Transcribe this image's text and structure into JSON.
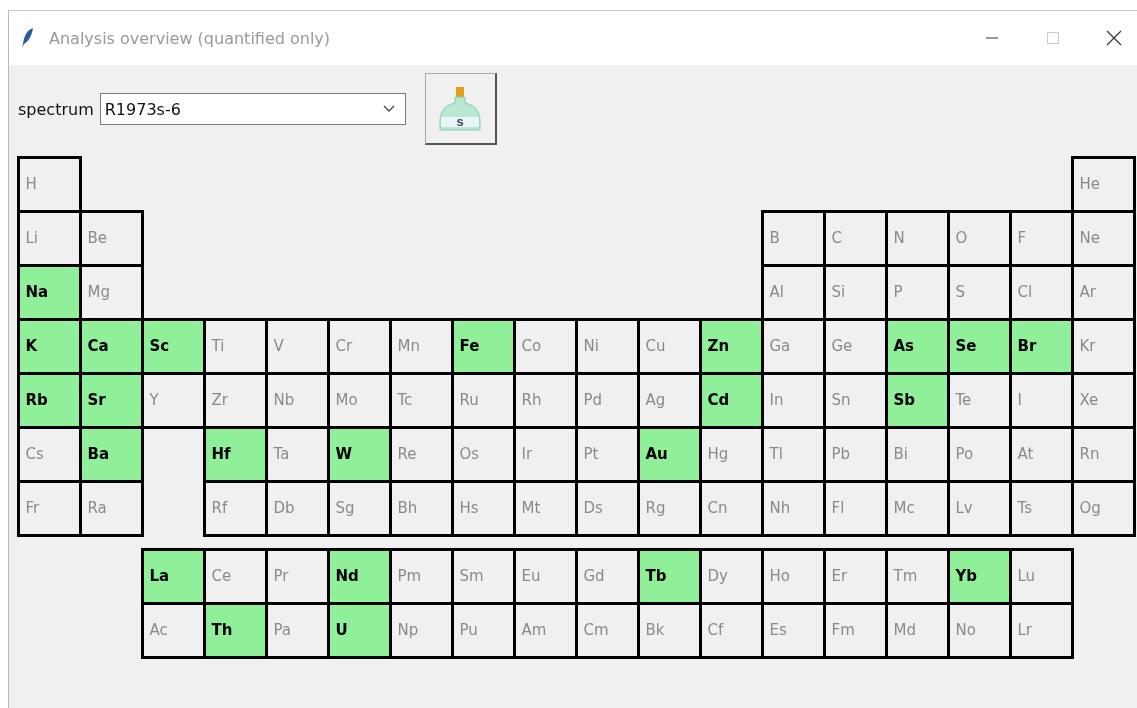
{
  "window": {
    "title": "Analysis overview (quantified only)"
  },
  "toolbar": {
    "label": "spectrum",
    "spectrum_select": {
      "value": "R1973s-6"
    },
    "flask_button": {
      "label": "s"
    }
  },
  "periods": [
    [
      {
        "symbol": "H",
        "quantified": false
      },
      {
        "symbol": "He",
        "quantified": false
      }
    ],
    [
      {
        "symbol": "Li",
        "quantified": false
      },
      {
        "symbol": "Be",
        "quantified": false
      },
      {
        "symbol": "B",
        "quantified": false
      },
      {
        "symbol": "C",
        "quantified": false
      },
      {
        "symbol": "N",
        "quantified": false
      },
      {
        "symbol": "O",
        "quantified": false
      },
      {
        "symbol": "F",
        "quantified": false
      },
      {
        "symbol": "Ne",
        "quantified": false
      }
    ],
    [
      {
        "symbol": "Na",
        "quantified": true
      },
      {
        "symbol": "Mg",
        "quantified": false
      },
      {
        "symbol": "Al",
        "quantified": false
      },
      {
        "symbol": "Si",
        "quantified": false
      },
      {
        "symbol": "P",
        "quantified": false
      },
      {
        "symbol": "S",
        "quantified": false
      },
      {
        "symbol": "Cl",
        "quantified": false
      },
      {
        "symbol": "Ar",
        "quantified": false
      }
    ],
    [
      {
        "symbol": "K",
        "quantified": true
      },
      {
        "symbol": "Ca",
        "quantified": true
      },
      {
        "symbol": "Sc",
        "quantified": true
      },
      {
        "symbol": "Ti",
        "quantified": false
      },
      {
        "symbol": "V",
        "quantified": false
      },
      {
        "symbol": "Cr",
        "quantified": false
      },
      {
        "symbol": "Mn",
        "quantified": false
      },
      {
        "symbol": "Fe",
        "quantified": true
      },
      {
        "symbol": "Co",
        "quantified": false
      },
      {
        "symbol": "Ni",
        "quantified": false
      },
      {
        "symbol": "Cu",
        "quantified": false
      },
      {
        "symbol": "Zn",
        "quantified": true
      },
      {
        "symbol": "Ga",
        "quantified": false
      },
      {
        "symbol": "Ge",
        "quantified": false
      },
      {
        "symbol": "As",
        "quantified": true
      },
      {
        "symbol": "Se",
        "quantified": true
      },
      {
        "symbol": "Br",
        "quantified": true
      },
      {
        "symbol": "Kr",
        "quantified": false
      }
    ],
    [
      {
        "symbol": "Rb",
        "quantified": true
      },
      {
        "symbol": "Sr",
        "quantified": true
      },
      {
        "symbol": "Y",
        "quantified": false
      },
      {
        "symbol": "Zr",
        "quantified": false
      },
      {
        "symbol": "Nb",
        "quantified": false
      },
      {
        "symbol": "Mo",
        "quantified": false
      },
      {
        "symbol": "Tc",
        "quantified": false
      },
      {
        "symbol": "Ru",
        "quantified": false
      },
      {
        "symbol": "Rh",
        "quantified": false
      },
      {
        "symbol": "Pd",
        "quantified": false
      },
      {
        "symbol": "Ag",
        "quantified": false
      },
      {
        "symbol": "Cd",
        "quantified": true
      },
      {
        "symbol": "In",
        "quantified": false
      },
      {
        "symbol": "Sn",
        "quantified": false
      },
      {
        "symbol": "Sb",
        "quantified": true
      },
      {
        "symbol": "Te",
        "quantified": false
      },
      {
        "symbol": "I",
        "quantified": false
      },
      {
        "symbol": "Xe",
        "quantified": false
      }
    ],
    [
      {
        "symbol": "Cs",
        "quantified": false
      },
      {
        "symbol": "Ba",
        "quantified": true
      },
      {
        "symbol": "Hf",
        "quantified": true
      },
      {
        "symbol": "Ta",
        "quantified": false
      },
      {
        "symbol": "W",
        "quantified": true
      },
      {
        "symbol": "Re",
        "quantified": false
      },
      {
        "symbol": "Os",
        "quantified": false
      },
      {
        "symbol": "Ir",
        "quantified": false
      },
      {
        "symbol": "Pt",
        "quantified": false
      },
      {
        "symbol": "Au",
        "quantified": true
      },
      {
        "symbol": "Hg",
        "quantified": false
      },
      {
        "symbol": "Tl",
        "quantified": false
      },
      {
        "symbol": "Pb",
        "quantified": false
      },
      {
        "symbol": "Bi",
        "quantified": false
      },
      {
        "symbol": "Po",
        "quantified": false
      },
      {
        "symbol": "At",
        "quantified": false
      },
      {
        "symbol": "Rn",
        "quantified": false
      }
    ],
    [
      {
        "symbol": "Fr",
        "quantified": false
      },
      {
        "symbol": "Ra",
        "quantified": false
      },
      {
        "symbol": "Rf",
        "quantified": false
      },
      {
        "symbol": "Db",
        "quantified": false
      },
      {
        "symbol": "Sg",
        "quantified": false
      },
      {
        "symbol": "Bh",
        "quantified": false
      },
      {
        "symbol": "Hs",
        "quantified": false
      },
      {
        "symbol": "Mt",
        "quantified": false
      },
      {
        "symbol": "Ds",
        "quantified": false
      },
      {
        "symbol": "Rg",
        "quantified": false
      },
      {
        "symbol": "Cn",
        "quantified": false
      },
      {
        "symbol": "Nh",
        "quantified": false
      },
      {
        "symbol": "Fl",
        "quantified": false
      },
      {
        "symbol": "Mc",
        "quantified": false
      },
      {
        "symbol": "Lv",
        "quantified": false
      },
      {
        "symbol": "Ts",
        "quantified": false
      },
      {
        "symbol": "Og",
        "quantified": false
      }
    ]
  ],
  "f_block": [
    [
      {
        "symbol": "La",
        "quantified": true
      },
      {
        "symbol": "Ce",
        "quantified": false
      },
      {
        "symbol": "Pr",
        "quantified": false
      },
      {
        "symbol": "Nd",
        "quantified": true
      },
      {
        "symbol": "Pm",
        "quantified": false
      },
      {
        "symbol": "Sm",
        "quantified": false
      },
      {
        "symbol": "Eu",
        "quantified": false
      },
      {
        "symbol": "Gd",
        "quantified": false
      },
      {
        "symbol": "Tb",
        "quantified": true
      },
      {
        "symbol": "Dy",
        "quantified": false
      },
      {
        "symbol": "Ho",
        "quantified": false
      },
      {
        "symbol": "Er",
        "quantified": false
      },
      {
        "symbol": "Tm",
        "quantified": false
      },
      {
        "symbol": "Yb",
        "quantified": true
      },
      {
        "symbol": "Lu",
        "quantified": false
      }
    ],
    [
      {
        "symbol": "Ac",
        "quantified": false
      },
      {
        "symbol": "Th",
        "quantified": true
      },
      {
        "symbol": "Pa",
        "quantified": false
      },
      {
        "symbol": "U",
        "quantified": true
      },
      {
        "symbol": "Np",
        "quantified": false
      },
      {
        "symbol": "Pu",
        "quantified": false
      },
      {
        "symbol": "Am",
        "quantified": false
      },
      {
        "symbol": "Cm",
        "quantified": false
      },
      {
        "symbol": "Bk",
        "quantified": false
      },
      {
        "symbol": "Cf",
        "quantified": false
      },
      {
        "symbol": "Es",
        "quantified": false
      },
      {
        "symbol": "Fm",
        "quantified": false
      },
      {
        "symbol": "Md",
        "quantified": false
      },
      {
        "symbol": "No",
        "quantified": false
      },
      {
        "symbol": "Lr",
        "quantified": false
      }
    ]
  ]
}
